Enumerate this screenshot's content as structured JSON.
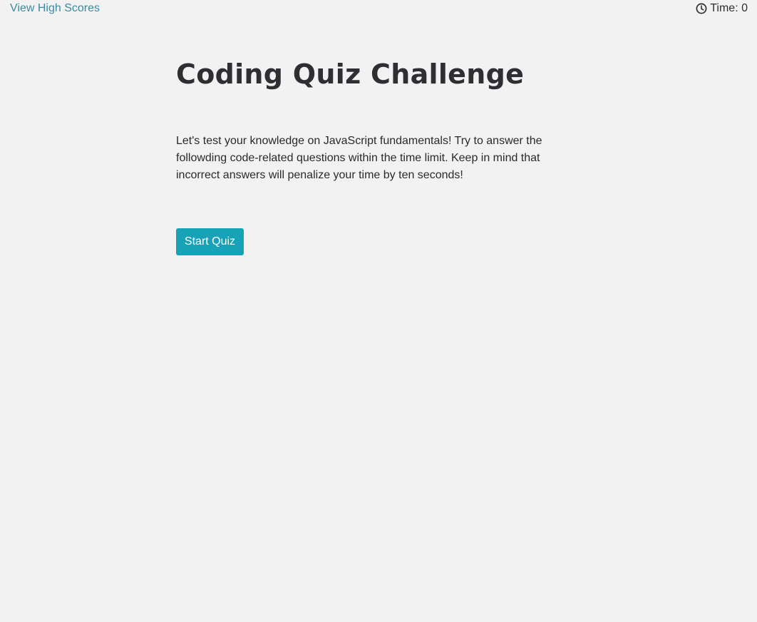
{
  "header": {
    "high_scores_link": "View High Scores",
    "timer": {
      "icon": "clock-icon",
      "label": "Time:",
      "value": "0"
    }
  },
  "main": {
    "title": "Coding Quiz Challenge",
    "intro": "Let's test your knowledge on JavaScript fundamentals! Try to answer the followding code-related questions within the time limit. Keep in mind that incorrect answers will penalize your time by ten seconds!",
    "start_button_label": "Start Quiz"
  },
  "colors": {
    "background": "#f2f2f2",
    "link": "#3d8a9e",
    "button": "#17a2b8",
    "text": "#2d2f33"
  }
}
